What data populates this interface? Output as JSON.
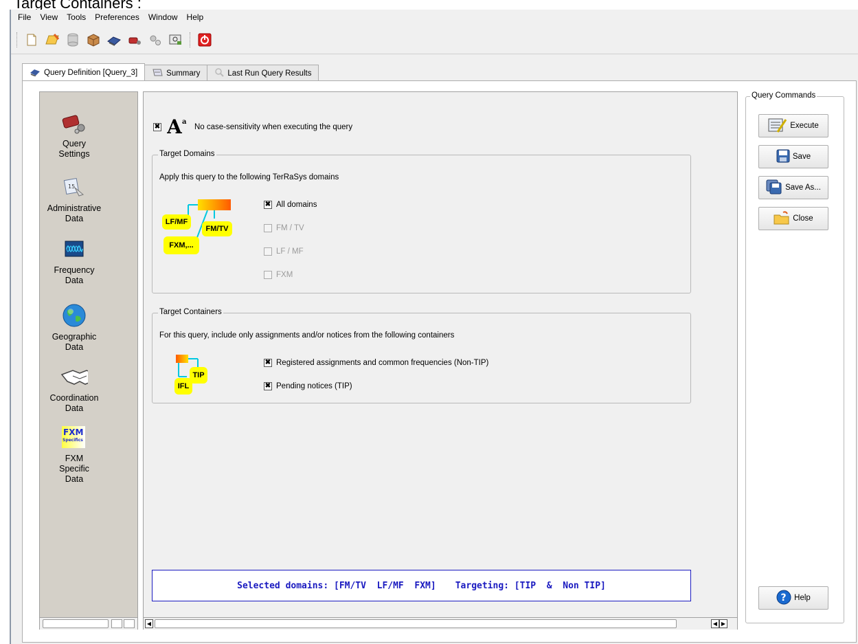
{
  "caption": "Target Containers :",
  "menu": [
    "File",
    "View",
    "Tools",
    "Preferences",
    "Window",
    "Help"
  ],
  "toolbar_icons": [
    "new-document-icon",
    "open-folder-icon",
    "database-icon",
    "package-icon",
    "query-icon",
    "tools-icon",
    "gears-icon",
    "search-window-icon",
    "power-icon"
  ],
  "tabs": [
    {
      "label": "Query Definition [Query_3]",
      "icon": "query-icon",
      "active": true
    },
    {
      "label": "Summary",
      "icon": "summary-icon",
      "active": false
    },
    {
      "label": "Last Run Query Results",
      "icon": "results-icon",
      "active": false
    }
  ],
  "nav": [
    {
      "label_lines": [
        "Query",
        "Settings"
      ],
      "icon": "query-settings-icon"
    },
    {
      "label_lines": [
        "Administrative",
        "Data"
      ],
      "icon": "calendar-icon"
    },
    {
      "label_lines": [
        "Frequency",
        "Data"
      ],
      "icon": "frequency-icon"
    },
    {
      "label_lines": [
        "Geographic",
        "Data"
      ],
      "icon": "globe-icon"
    },
    {
      "label_lines": [
        "Coordination",
        "Data"
      ],
      "icon": "handshake-icon"
    },
    {
      "label_lines": [
        "FXM",
        "Specific",
        "Data"
      ],
      "icon": "fxm-specifics-icon"
    }
  ],
  "case_sensitivity": {
    "label": "No case-sensitivity when executing the query",
    "checked": true
  },
  "domains": {
    "title": "Target Domains",
    "description": "Apply this query to the following TerRaSys domains",
    "diagram_labels": [
      "LF/MF",
      "FM/TV",
      "FXM,..."
    ],
    "options": [
      {
        "label": "All domains",
        "checked": true,
        "enabled": true
      },
      {
        "label": "FM / TV",
        "checked": false,
        "enabled": false
      },
      {
        "label": "LF / MF",
        "checked": false,
        "enabled": false
      },
      {
        "label": "FXM",
        "checked": false,
        "enabled": false
      }
    ]
  },
  "containers": {
    "title": "Target Containers",
    "description": "For this query, include only assignments and/or notices from the following containers",
    "diagram_labels": [
      "TIP",
      "IFL"
    ],
    "options": [
      {
        "label": "Registered assignments and common frequencies (Non-TIP)",
        "checked": true
      },
      {
        "label": "Pending notices (TIP)",
        "checked": true
      }
    ]
  },
  "status": {
    "domains": "Selected domains: [FM/TV  LF/MF  FXM]",
    "targeting": "Targeting: [TIP  &  Non TIP]"
  },
  "commands": {
    "title": "Query Commands",
    "execute": "Execute",
    "save": "Save",
    "save_as": "Save As...",
    "close": "Close",
    "help": "Help"
  },
  "colors": {
    "status_text": "#1a1ac0",
    "diagram_box": "#ffff00",
    "diagram_line": "#00c8e0",
    "accent": "#ff6600"
  }
}
